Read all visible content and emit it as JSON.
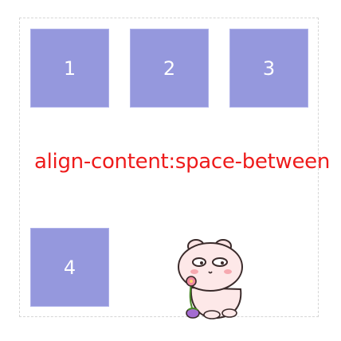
{
  "title": "align-content:space-between",
  "items": [
    {
      "label": "1"
    },
    {
      "label": "2"
    },
    {
      "label": "3"
    },
    {
      "label": "4"
    }
  ],
  "colors": {
    "item_bg": "#9598dd",
    "title": "#ee1b1b"
  },
  "sticker_icon": "bunny-with-flower-icon"
}
